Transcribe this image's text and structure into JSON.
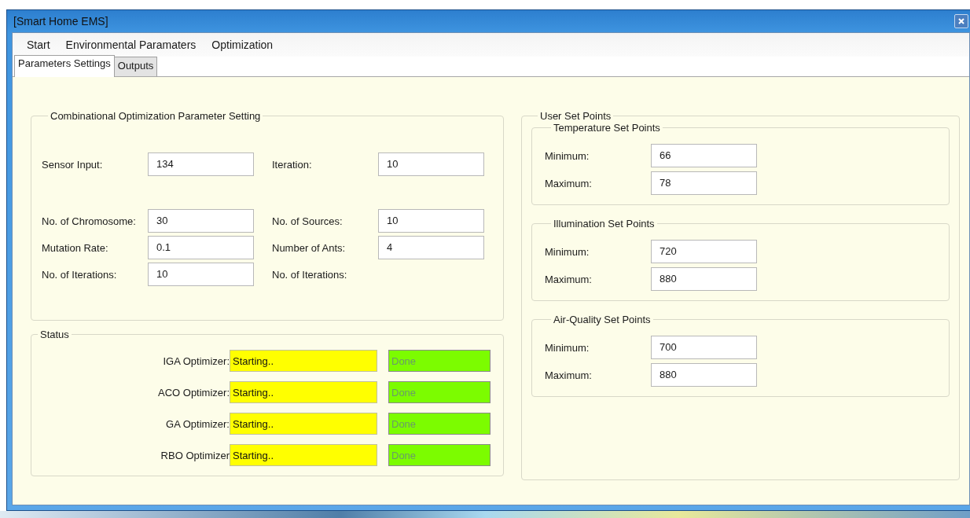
{
  "window": {
    "title": "[Smart Home EMS]"
  },
  "menu": [
    "Start",
    "Environmental Paramaters",
    "Optimization"
  ],
  "tabs": [
    {
      "label": "Parameters Settings",
      "selected": true
    },
    {
      "label": "Outputs",
      "selected": false
    }
  ],
  "optimization_group": {
    "title": "Combinational Optimization Parameter Setting",
    "rows": [
      [
        {
          "label": "Sensor Input:",
          "value": "134"
        },
        {
          "label": "Iteration:",
          "value": "10"
        }
      ],
      [
        {
          "label": "No. of Chromosome:",
          "value": "30"
        },
        {
          "label": "No. of Sources:",
          "value": "10"
        }
      ],
      [
        {
          "label": "Mutation Rate:",
          "value": "0.1"
        },
        {
          "label": "Number of Ants:",
          "value": "4"
        }
      ],
      [
        {
          "label": "No. of Iterations:",
          "value": "10"
        },
        {
          "label": "No. of Iterations:"
        }
      ]
    ]
  },
  "status_group": {
    "title": "Status",
    "rows": [
      {
        "label": "IGA Optimizer:",
        "progress": "Starting..",
        "done": "Done"
      },
      {
        "label": "ACO Optimizer:",
        "progress": "Starting..",
        "done": "Done"
      },
      {
        "label": "GA Optimizer:",
        "progress": "Starting..",
        "done": "Done"
      },
      {
        "label": "RBO Optimizer",
        "progress": "Starting..",
        "done": "Done"
      }
    ]
  },
  "set_points": {
    "title": "User Set Points",
    "groups": [
      {
        "title": "Temperature Set Points",
        "minimum_label": "Minimum:",
        "minimum": "66",
        "maximum_label": "Maximum:",
        "maximum": "78"
      },
      {
        "title": "Illumination Set Points",
        "minimum_label": "Minimum:",
        "minimum": "720",
        "maximum_label": "Maximum:",
        "maximum": "880"
      },
      {
        "title": "Air-Quality  Set Points",
        "minimum_label": "Minimum:",
        "minimum": "700",
        "maximum_label": "Maximum:",
        "maximum": "880"
      }
    ]
  }
}
